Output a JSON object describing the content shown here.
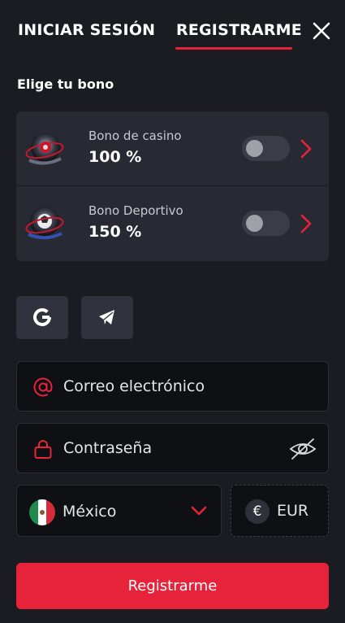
{
  "tabs": {
    "login": "INICIAR SESIÓN",
    "register": "REGISTRARME",
    "active": "register"
  },
  "bonus": {
    "title": "Elige tu bono",
    "items": [
      {
        "name": "Bono de casino",
        "value": "100 %",
        "enabled": false
      },
      {
        "name": "Bono Deportivo",
        "value": "150 %",
        "enabled": false
      }
    ]
  },
  "social": [
    "google-icon",
    "telegram-icon"
  ],
  "form": {
    "email_placeholder": "Correo electrónico",
    "password_placeholder": "Contraseña",
    "country": "México",
    "currency_symbol": "€",
    "currency": "EUR",
    "submit": "Registrarme"
  },
  "colors": {
    "accent": "#e6233b",
    "background": "#1a1c22",
    "card": "#272a33",
    "field": "#0f1013"
  }
}
